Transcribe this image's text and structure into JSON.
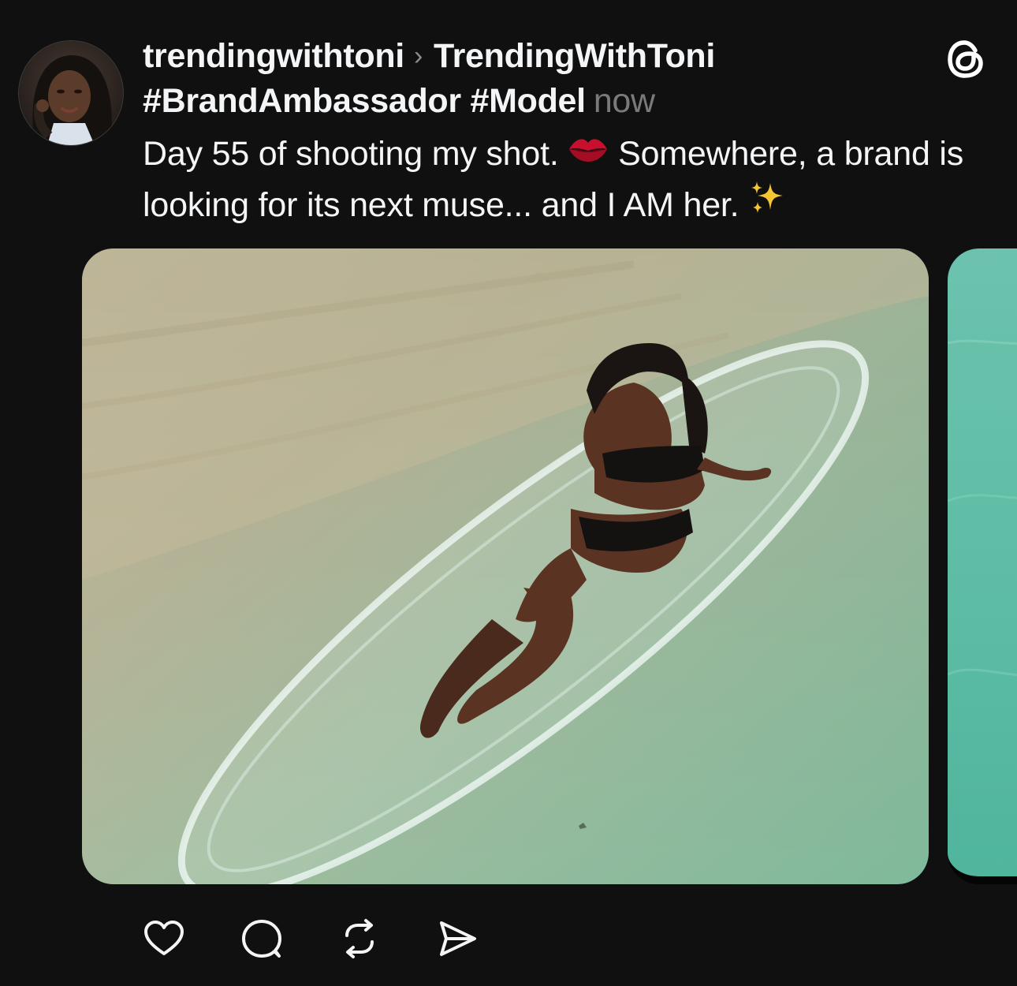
{
  "post": {
    "username": "trendingwithtoni",
    "separator": "›",
    "community": "TrendingWithToni",
    "hashtags": "#BrandAmbassador #Model",
    "timestamp": "now",
    "caption_part1": "Day 55 of shooting my shot. ",
    "caption_emoji1": "💋",
    "caption_part2": "Somewhere, a brand is looking for its next muse... and I AM her. ",
    "caption_emoji2": "✨"
  },
  "icons": {
    "app_logo": "threads-logo-icon",
    "actions": [
      "heart-icon",
      "comment-icon",
      "repost-icon",
      "share-icon"
    ]
  },
  "colors": {
    "background": "#101010",
    "text_primary": "#f3f5f7",
    "text_secondary": "#7a7a7a",
    "water": "#8fbf9e",
    "sand": "#c9bf9f"
  }
}
